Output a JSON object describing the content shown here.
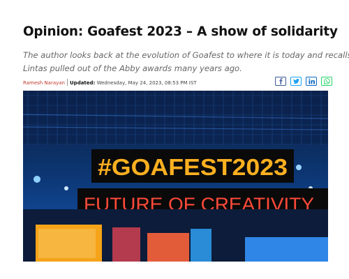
{
  "article": {
    "headline": "Opinion: Goafest 2023 – A show of solidarity",
    "summary": "The author looks back at the evolution of Goafest to where it is today and recalls how\nLintas pulled out of the Abby awards many years ago.",
    "author": "Ramesh Narayan",
    "updated_label": "Updated:",
    "updated_value": "Wednesday, May 24, 2023, 08:53 PM IST",
    "share": [
      {
        "icon": "facebook-icon",
        "color": "#3b5998"
      },
      {
        "icon": "twitter-icon",
        "color": "#1da1f2"
      },
      {
        "icon": "linkedin-icon",
        "color": "#0a66c2"
      },
      {
        "icon": "whatsapp-icon",
        "color": "#25d366"
      }
    ]
  },
  "hero": {
    "sign_top": "#GOAFEST2023",
    "sign_bottom": "FUTURE OF CREATIVITY"
  },
  "colors": {
    "author": "#c0392b",
    "sign_top_text": "#ffb020",
    "sign_bottom_text": "#ff4a3a",
    "stage_blue": "#0d3a7a"
  }
}
